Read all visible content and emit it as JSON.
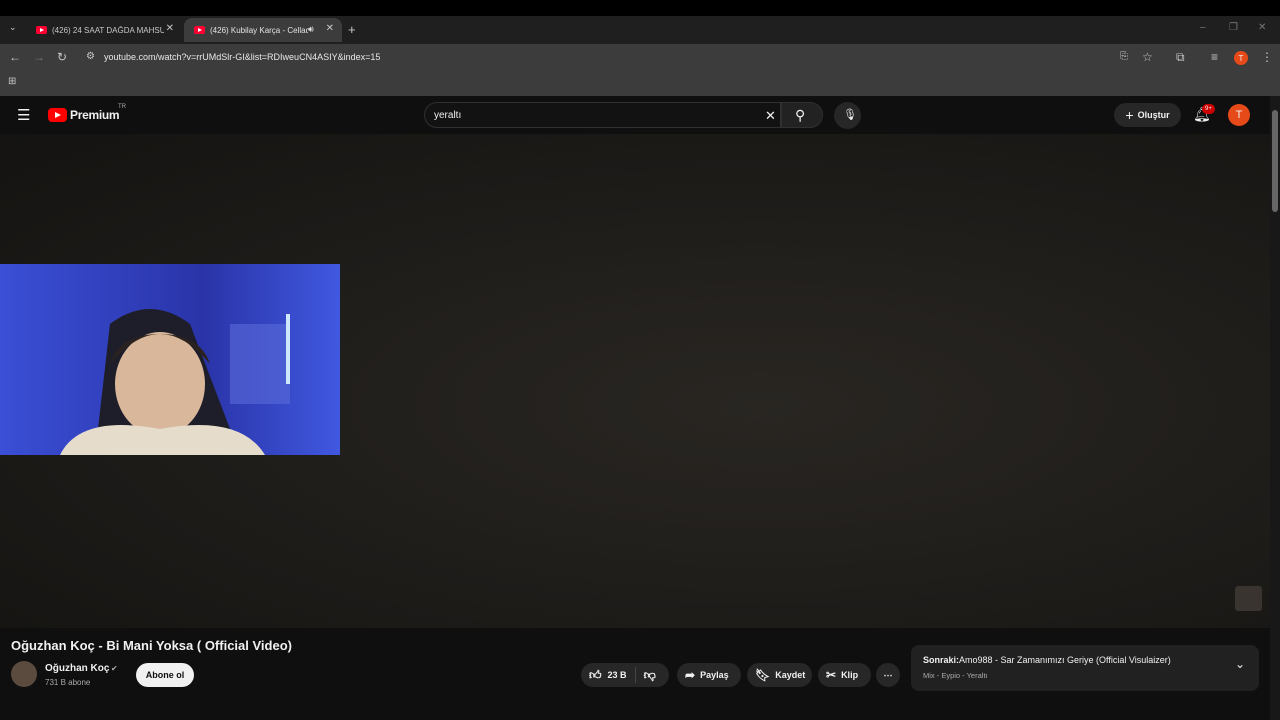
{
  "browser": {
    "tabs": [
      {
        "title": "(426) 24 SAAT DAĞDA MAHSUR",
        "active": false
      },
      {
        "title": "(426) Kubilay Karça - Cellad",
        "active": true
      }
    ],
    "url": "youtube.com/watch?v=rrUMdSlr-GI&list=RDIweuCN4ASIY&index=15",
    "profile_initial": "T"
  },
  "youtube": {
    "logo_text": "Premium",
    "region": "TR",
    "search_value": "yeraltı",
    "create_label": "Oluştur",
    "notif_badge": "9+",
    "avatar_initial": "T",
    "video": {
      "title": "Oğuzhan Koç - Bi Mani Yoksa ( Official Video)",
      "channel": "Oğuzhan Koç",
      "subscribers": "731 B abone",
      "subscribe_label": "Abone ol",
      "likes": "23 B",
      "share_label": "Paylaş",
      "save_label": "Kaydet",
      "clip_label": "Klip"
    },
    "up_next": {
      "prefix": "Sonraki:",
      "title": "Amo988 - Sar Zamanımızı Geriye (Official Visulaizer)",
      "subtitle": "Mix - Eypio - Yeraltı"
    }
  },
  "colors": {
    "brand": "#ff0000",
    "accent_avatar": "#e64a19"
  }
}
